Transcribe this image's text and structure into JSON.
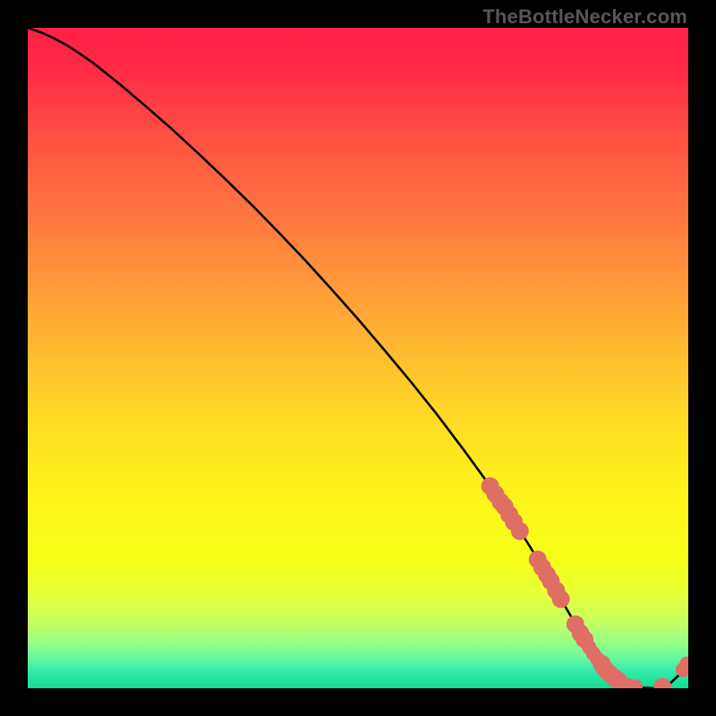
{
  "credit": "TheBottleNecker.com",
  "colors": {
    "bg": "#000000",
    "curve": "#000000",
    "marker": "#df6e64",
    "credit": "#565656"
  },
  "gradient_stops": [
    {
      "offset": 0.0,
      "color": "#ff1f47"
    },
    {
      "offset": 0.06,
      "color": "#ff2a46"
    },
    {
      "offset": 0.18,
      "color": "#ff5542"
    },
    {
      "offset": 0.32,
      "color": "#ff823e"
    },
    {
      "offset": 0.46,
      "color": "#ffb133"
    },
    {
      "offset": 0.58,
      "color": "#ffd826"
    },
    {
      "offset": 0.7,
      "color": "#fff31a"
    },
    {
      "offset": 0.81,
      "color": "#f6ff18"
    },
    {
      "offset": 0.86,
      "color": "#e4ff3a"
    },
    {
      "offset": 0.9,
      "color": "#c4ff61"
    },
    {
      "offset": 0.93,
      "color": "#99ff86"
    },
    {
      "offset": 0.955,
      "color": "#66f7a0"
    },
    {
      "offset": 0.975,
      "color": "#33e9aa"
    },
    {
      "offset": 1.0,
      "color": "#11dd92"
    }
  ],
  "chart_data": {
    "type": "line",
    "title": "",
    "xlabel": "",
    "ylabel": "",
    "xlim": [
      0,
      100
    ],
    "ylim": [
      0,
      100
    ],
    "series": [
      {
        "name": "curve",
        "x": [
          0,
          2,
          4,
          6,
          8,
          10,
          14,
          18,
          22,
          26,
          30,
          34,
          38,
          42,
          46,
          50,
          54,
          58,
          62,
          66,
          70,
          73,
          76,
          79,
          81,
          83,
          85,
          87,
          89,
          91,
          93,
          95,
          97,
          98.5,
          100
        ],
        "values": [
          100,
          99.3,
          98.4,
          97.3,
          96.0,
          94.6,
          91.4,
          88.0,
          84.5,
          80.8,
          77.0,
          73.1,
          69.0,
          64.8,
          60.4,
          55.9,
          51.2,
          46.4,
          41.4,
          36.1,
          30.6,
          26.2,
          21.5,
          16.5,
          13.0,
          9.6,
          6.4,
          3.8,
          1.8,
          0.7,
          0.1,
          0.0,
          0.5,
          1.9,
          4.0
        ]
      }
    ],
    "markers": [
      {
        "x": 70.0,
        "y": 30.6,
        "r": 1.35
      },
      {
        "x": 70.8,
        "y": 29.4,
        "r": 1.35
      },
      {
        "x": 71.6,
        "y": 28.2,
        "r": 1.35
      },
      {
        "x": 72.2,
        "y": 27.5,
        "r": 1.35
      },
      {
        "x": 72.9,
        "y": 26.3,
        "r": 1.35
      },
      {
        "x": 73.6,
        "y": 25.2,
        "r": 1.35
      },
      {
        "x": 74.5,
        "y": 23.8,
        "r": 1.35
      },
      {
        "x": 77.2,
        "y": 19.5,
        "r": 1.35
      },
      {
        "x": 77.9,
        "y": 18.3,
        "r": 1.35
      },
      {
        "x": 78.6,
        "y": 17.2,
        "r": 1.35
      },
      {
        "x": 79.2,
        "y": 16.2,
        "r": 1.35
      },
      {
        "x": 80.0,
        "y": 14.8,
        "r": 1.35
      },
      {
        "x": 80.7,
        "y": 13.5,
        "r": 1.35
      },
      {
        "x": 82.9,
        "y": 9.7,
        "r": 1.35
      },
      {
        "x": 83.7,
        "y": 8.3,
        "r": 1.35
      },
      {
        "x": 84.3,
        "y": 7.4,
        "r": 1.35
      },
      {
        "x": 85.0,
        "y": 6.2,
        "r": 1.1
      },
      {
        "x": 85.6,
        "y": 5.3,
        "r": 1.1
      },
      {
        "x": 86.2,
        "y": 4.5,
        "r": 1.1
      },
      {
        "x": 86.9,
        "y": 3.7,
        "r": 1.35
      },
      {
        "x": 87.4,
        "y": 2.9,
        "r": 1.35
      },
      {
        "x": 88.1,
        "y": 2.2,
        "r": 1.35
      },
      {
        "x": 88.8,
        "y": 1.6,
        "r": 1.35
      },
      {
        "x": 89.4,
        "y": 1.2,
        "r": 1.35
      },
      {
        "x": 90.0,
        "y": 0.8,
        "r": 1.1
      },
      {
        "x": 90.6,
        "y": 0.5,
        "r": 1.1
      },
      {
        "x": 91.2,
        "y": 0.3,
        "r": 1.1
      },
      {
        "x": 92.0,
        "y": 0.2,
        "r": 1.1
      },
      {
        "x": 96.1,
        "y": 0.2,
        "r": 1.35
      },
      {
        "x": 99.2,
        "y": 2.8,
        "r": 1.1
      },
      {
        "x": 99.8,
        "y": 3.7,
        "r": 1.1
      }
    ]
  }
}
